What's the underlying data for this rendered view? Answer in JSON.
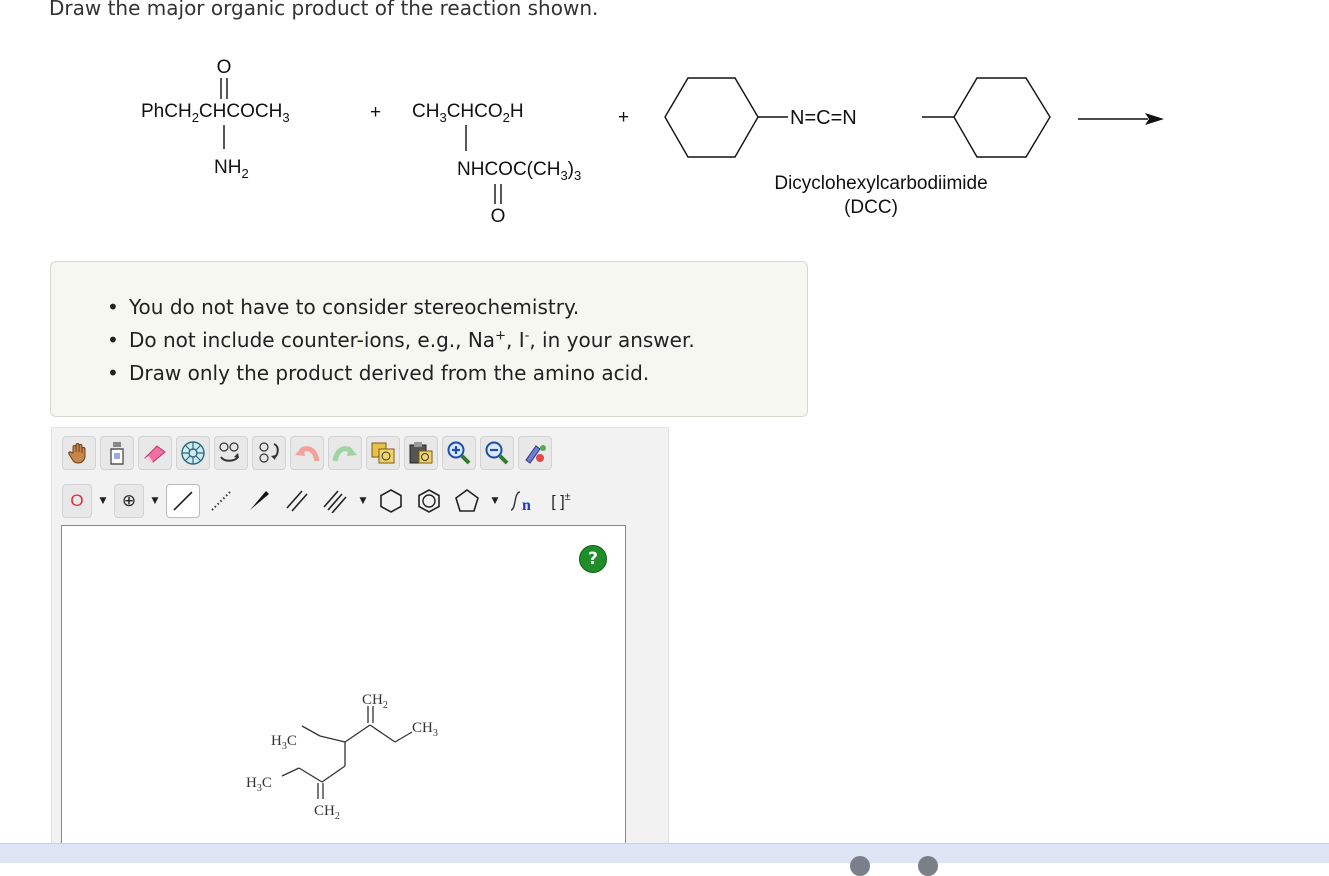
{
  "question": "Draw the major organic product of the reaction shown.",
  "reaction": {
    "reactant1": {
      "main": "PhCH",
      "sub1": "2",
      "mid": "CHCOCH",
      "sub2": "3",
      "carbonyl_o": "O",
      "amine": "NH",
      "amine_sub": "2"
    },
    "plus": "+",
    "reactant2": {
      "main": "CH",
      "sub1": "3",
      "mid": "CHCO",
      "sub2": "2",
      "end": "H",
      "sub_group": "NHCOC(CH",
      "sub3": "3",
      "close": ")",
      "sub4": "3",
      "carbonyl_o": "O"
    },
    "reagent": {
      "formula": "N=C=N",
      "name": "Dicyclohexylcarbodiimide",
      "abbr": "(DCC)"
    }
  },
  "instructions": [
    "You do not have to consider stereochemistry.",
    "Do not include counter-ions, e.g., Na",
    "Draw only the product derived from the amino acid."
  ],
  "instruction2_parts": {
    "plus": "+",
    "sep": ", I",
    "minus": "-",
    "tail": ", in your answer."
  },
  "toolbar": {
    "element_label": "O",
    "charge_label": "⊕",
    "sgroup_label": "n",
    "bracket_label": "[ ]",
    "bracket_charge": "±",
    "help_label": "?"
  },
  "canvas_molecule": {
    "labels": {
      "ch2_top": "CH",
      "ch2_top_sub": "2",
      "ch3_right": "CH",
      "ch3_right_sub": "3",
      "h3c_upper": "H",
      "h3c_upper_sub": "3",
      "h3c_upper_c": "C",
      "h3c_lower": "H",
      "h3c_lower_sub": "3",
      "h3c_lower_c": "C",
      "ch2_bottom": "CH",
      "ch2_bottom_sub": "2"
    }
  },
  "icons": [
    "hand-icon",
    "bottle-icon",
    "eraser-icon",
    "template-icon",
    "rotate-icon",
    "flip-icon",
    "undo-icon",
    "redo-icon",
    "copy-icon",
    "paste-icon",
    "zoom-in-icon",
    "zoom-out-icon",
    "clean-icon",
    "single-bond-icon",
    "stereo-bond-icon",
    "wedge-bond-icon",
    "double-bond-icon",
    "triple-bond-icon",
    "cyclohexane-icon",
    "benzene-icon",
    "cyclopentane-icon",
    "sgroup-icon",
    "bracket-icon"
  ]
}
